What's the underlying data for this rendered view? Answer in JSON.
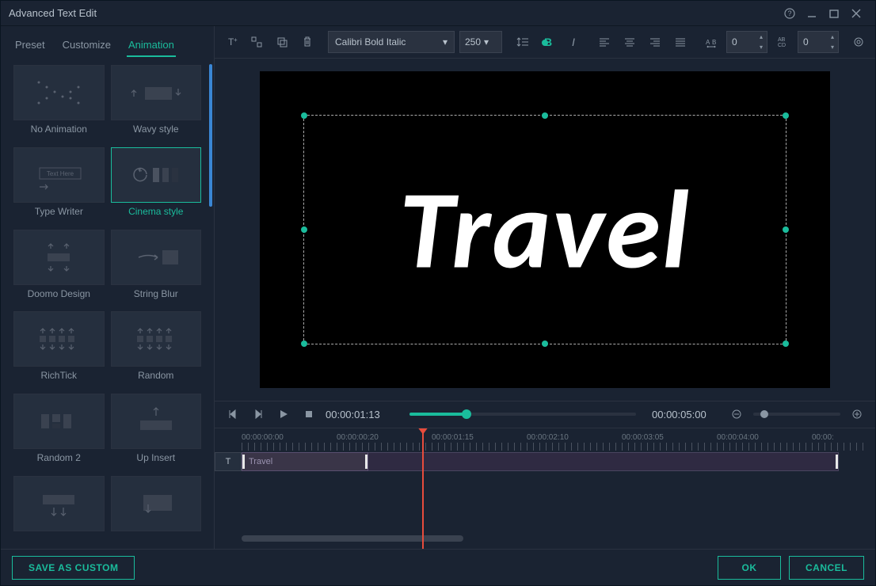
{
  "window": {
    "title": "Advanced Text Edit"
  },
  "tabs": {
    "preset": "Preset",
    "customize": "Customize",
    "animation": "Animation",
    "active": "animation"
  },
  "presets": [
    {
      "name": "No Animation"
    },
    {
      "name": "Wavy style"
    },
    {
      "name": "Type Writer",
      "hint": "Text Here"
    },
    {
      "name": "Cinema style",
      "selected": true
    },
    {
      "name": "Doomo Design"
    },
    {
      "name": "String Blur"
    },
    {
      "name": "RichTick"
    },
    {
      "name": "Random"
    },
    {
      "name": "Random 2"
    },
    {
      "name": "Up Insert"
    }
  ],
  "toolbar": {
    "font": "Calibri Bold Italic",
    "size": "250",
    "bold_color": "#1abc9c",
    "spacing1": "0",
    "spacing2": "0"
  },
  "canvas": {
    "text": "Travel"
  },
  "playback": {
    "current": "00:00:01:13",
    "duration": "00:00:05:00"
  },
  "timeline": {
    "marks": [
      "00:00:00:00",
      "00:00:00:20",
      "00:00:01:15",
      "00:00:02:10",
      "00:00:03:05",
      "00:00:04:00",
      "00:00:"
    ],
    "track_label": "T",
    "clip_name": "Travel"
  },
  "footer": {
    "save": "SAVE AS CUSTOM",
    "ok": "OK",
    "cancel": "CANCEL"
  }
}
